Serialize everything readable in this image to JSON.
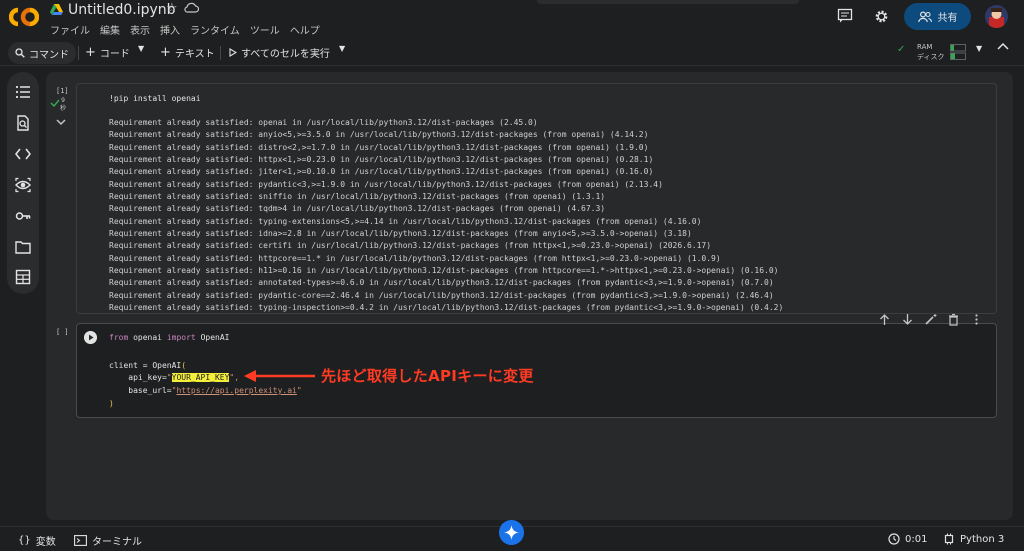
{
  "header": {
    "file_title": "Untitled0.ipynb",
    "menu": [
      "ファイル",
      "編集",
      "表示",
      "挿入",
      "ランタイム",
      "ツール",
      "ヘルプ"
    ],
    "share_label": "共有"
  },
  "toolbar": {
    "command_label": "コマンド",
    "add_code_label": "コード",
    "add_text_label": "テキスト",
    "run_all_label": "すべてのセルを実行",
    "ram_label": "RAM",
    "disk_label": "ディスク"
  },
  "cell1": {
    "exec_count": "[1]",
    "exec_time_value": "9",
    "exec_time_unit": "秒",
    "code": "!pip install openai",
    "output_lines": [
      "Requirement already satisfied: openai in /usr/local/lib/python3.12/dist-packages (2.45.0)",
      "Requirement already satisfied: anyio<5,>=3.5.0 in /usr/local/lib/python3.12/dist-packages (from openai) (4.14.2)",
      "Requirement already satisfied: distro<2,>=1.7.0 in /usr/local/lib/python3.12/dist-packages (from openai) (1.9.0)",
      "Requirement already satisfied: httpx<1,>=0.23.0 in /usr/local/lib/python3.12/dist-packages (from openai) (0.28.1)",
      "Requirement already satisfied: jiter<1,>=0.10.0 in /usr/local/lib/python3.12/dist-packages (from openai) (0.16.0)",
      "Requirement already satisfied: pydantic<3,>=1.9.0 in /usr/local/lib/python3.12/dist-packages (from openai) (2.13.4)",
      "Requirement already satisfied: sniffio in /usr/local/lib/python3.12/dist-packages (from openai) (1.3.1)",
      "Requirement already satisfied: tqdm>4 in /usr/local/lib/python3.12/dist-packages (from openai) (4.67.3)",
      "Requirement already satisfied: typing-extensions<5,>=4.14 in /usr/local/lib/python3.12/dist-packages (from openai) (4.16.0)",
      "Requirement already satisfied: idna>=2.8 in /usr/local/lib/python3.12/dist-packages (from anyio<5,>=3.5.0->openai) (3.18)",
      "Requirement already satisfied: certifi in /usr/local/lib/python3.12/dist-packages (from httpx<1,>=0.23.0->openai) (2026.6.17)",
      "Requirement already satisfied: httpcore==1.* in /usr/local/lib/python3.12/dist-packages (from httpx<1,>=0.23.0->openai) (1.0.9)",
      "Requirement already satisfied: h11>=0.16 in /usr/local/lib/python3.12/dist-packages (from httpcore==1.*->httpx<1,>=0.23.0->openai) (0.16.0)",
      "Requirement already satisfied: annotated-types>=0.6.0 in /usr/local/lib/python3.12/dist-packages (from pydantic<3,>=1.9.0->openai) (0.7.0)",
      "Requirement already satisfied: pydantic-core==2.46.4 in /usr/local/lib/python3.12/dist-packages (from pydantic<3,>=1.9.0->openai) (2.46.4)",
      "Requirement already satisfied: typing-inspection>=0.4.2 in /usr/local/lib/python3.12/dist-packages (from pydantic<3,>=1.9.0->openai) (0.4.2)"
    ]
  },
  "cell2": {
    "exec_count": "[ ]",
    "kw_from": "from",
    "module": "openai",
    "kw_import": "import",
    "name": "OpenAI",
    "line3_prefix": "client = OpenAI",
    "open_paren": "(",
    "api_key_prefix": "    api_key=",
    "quote": "\"",
    "api_key_value": "YOUR_API_KEY",
    "api_key_suffix": "\",",
    "base_url_prefix": "    base_url=",
    "base_url_value": "https://api.perplexity.ai",
    "base_url_suffix": "\"",
    "close_paren": ")"
  },
  "annotation": {
    "text": "先ほど取得したAPIキーに変更",
    "color": "#ff3b24"
  },
  "statusbar": {
    "variables_label": "変数",
    "terminal_label": "ターミナル",
    "elapsed": "0:01",
    "runtime": "Python 3"
  },
  "colors": {
    "accent": "#0d4a7d",
    "highlight": "#f5ef3b",
    "gemini": "#1a73e8"
  }
}
